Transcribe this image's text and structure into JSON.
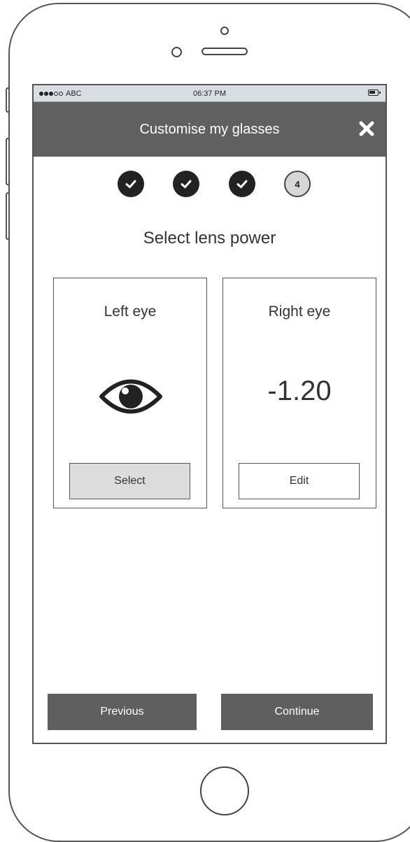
{
  "statusbar": {
    "carrier": "ABC",
    "time": "06:37 PM"
  },
  "navbar": {
    "title": "Customise my glasses"
  },
  "steps": {
    "current_label": "4"
  },
  "section": {
    "title": "Select lens power"
  },
  "left_card": {
    "title": "Left eye",
    "button": "Select"
  },
  "right_card": {
    "title": "Right eye",
    "value": "-1.20",
    "button": "Edit"
  },
  "footer": {
    "previous": "Previous",
    "continue": "Continue"
  },
  "colors": {
    "navbar": "#606060",
    "footer_button": "#5f5f5f",
    "step_done": "#222222",
    "statusbar": "#d9dee3"
  }
}
